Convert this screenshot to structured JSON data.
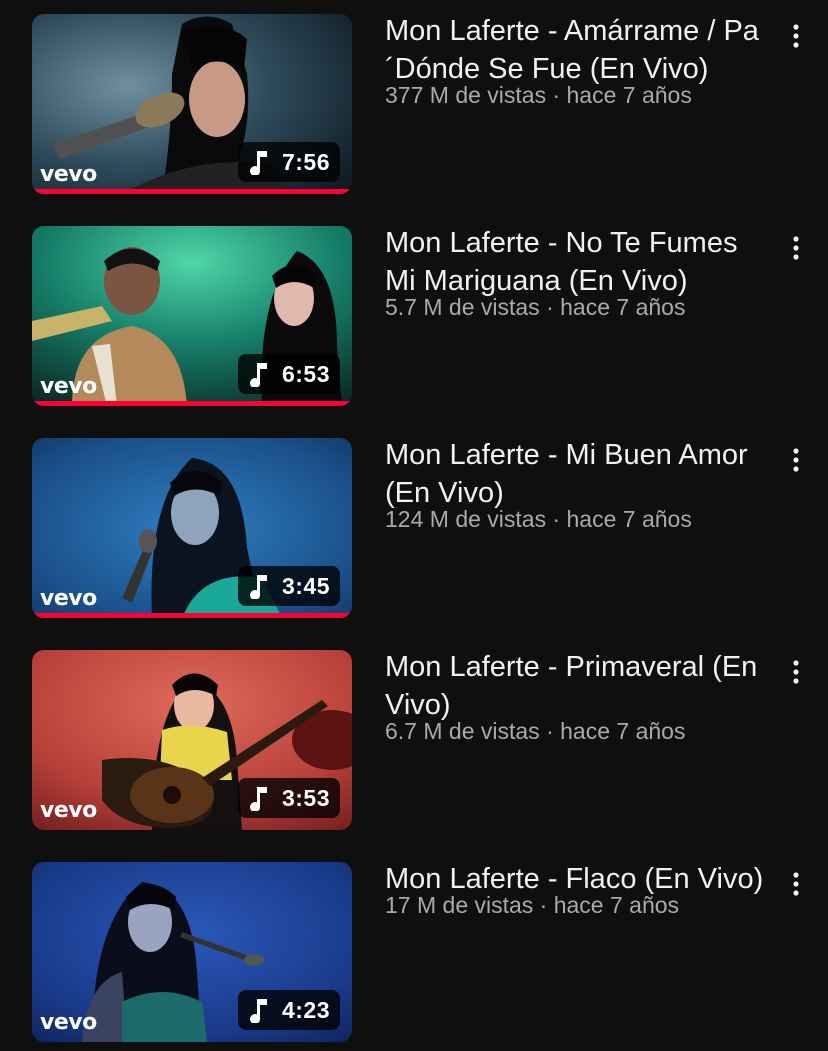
{
  "videos": [
    {
      "title": "Mon Laferte - Amárrame / Pa´Dónde Se Fue (En Vivo)",
      "meta": "377 M de vistas · hace 7 años",
      "duration": "7:56",
      "brand": "vevo",
      "watched_fraction": 1.0
    },
    {
      "title": "Mon Laferte - No Te Fumes Mi Mariguana (En Vivo)",
      "meta": "5.7 M de vistas · hace 7 años",
      "duration": "6:53",
      "brand": "vevo",
      "watched_fraction": 1.0
    },
    {
      "title": "Mon Laferte - Mi Buen Amor (En Vivo)",
      "meta": "124 M de vistas · hace 7 años",
      "duration": "3:45",
      "brand": "vevo",
      "watched_fraction": 1.0
    },
    {
      "title": "Mon Laferte - Primaveral (En Vivo)",
      "meta": "6.7 M de vistas · hace 7 años",
      "duration": "3:53",
      "brand": "vevo",
      "watched_fraction": 0
    },
    {
      "title": "Mon Laferte - Flaco (En Vivo)",
      "meta": "17 M de vistas · hace 7 años",
      "duration": "4:23",
      "brand": "vevo",
      "watched_fraction": 0
    }
  ],
  "icons": {
    "duration_badge": "music-note-icon",
    "row_action": "more-vertical-icon"
  },
  "colors": {
    "background": "#0f0f0f",
    "title_text": "#f1f1f1",
    "meta_text": "#aaaaaa",
    "progress_bar": "#ff0033"
  }
}
